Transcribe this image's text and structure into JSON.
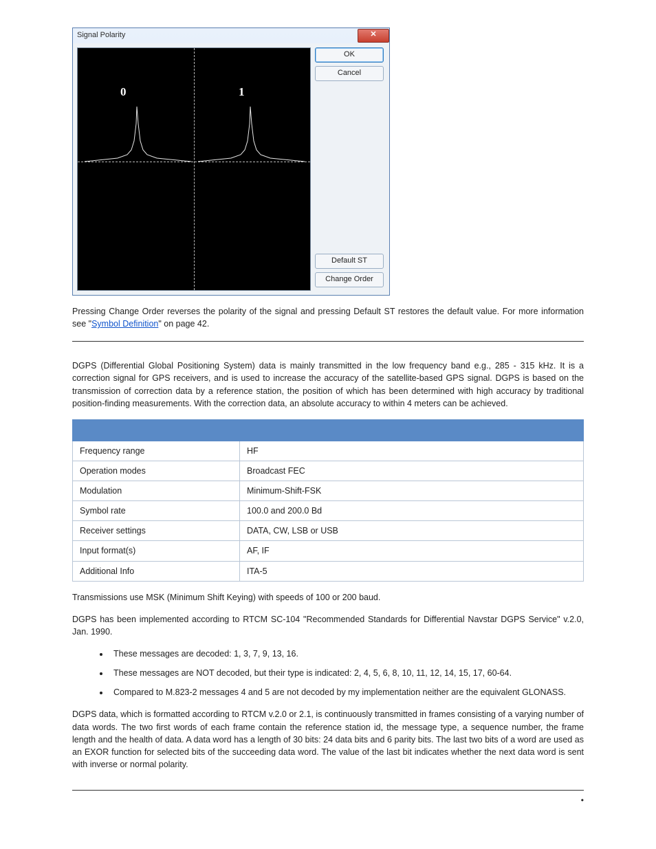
{
  "dialog": {
    "title": "Signal Polarity",
    "close_symbol": "✕",
    "label0": "0",
    "label1": "1",
    "buttons": {
      "ok": "OK",
      "cancel": "Cancel",
      "default_st": "Default ST",
      "change_order": "Change Order"
    }
  },
  "caption": {
    "before_link": "Pressing Change Order reverses the polarity of the signal and pressing Default ST restores the default value. For more information see \"",
    "link_text": "Symbol Definition",
    "after_link": "\" on page 42."
  },
  "intro": "DGPS (Differential Global Positioning System) data is mainly transmitted in the low frequency band e.g., 285 - 315 kHz. It is a correction signal for GPS receivers, and is used to increase the accuracy of the satellite-based GPS signal. DGPS is based on the transmission of correction data by a reference station, the position of which has been determined with high accuracy by traditional position-finding measurements. With the correction data, an absolute accuracy to within 4 meters can be achieved.",
  "spec_table": [
    {
      "k": "Frequency range",
      "v": "HF"
    },
    {
      "k": "Operation modes",
      "v": "Broadcast FEC"
    },
    {
      "k": "Modulation",
      "v": "Minimum-Shift-FSK"
    },
    {
      "k": "Symbol rate",
      "v": "100.0 and 200.0 Bd"
    },
    {
      "k": "Receiver settings",
      "v": "DATA, CW, LSB or USB"
    },
    {
      "k": "Input format(s)",
      "v": "AF, IF"
    },
    {
      "k": "Additional Info",
      "v": "ITA-5"
    }
  ],
  "after_table_1": "Transmissions use MSK (Minimum Shift Keying) with speeds of 100 or 200 baud.",
  "after_table_2": "DGPS has been implemented according to RTCM SC-104 \"Recommended Standards for Differential Navstar DGPS Service\" v.2.0, Jan. 1990.",
  "bullets": [
    "These messages are decoded: 1, 3, 7, 9, 13, 16.",
    "These messages are NOT decoded, but their type is indicated: 2, 4, 5, 6, 8, 10, 11, 12, 14, 15, 17, 60-64.",
    "Compared to M.823-2 messages 4 and 5 are not decoded by my implementation neither are the equivalent GLONASS."
  ],
  "closing": "DGPS data, which is formatted according to RTCM v.2.0 or 2.1, is continuously transmitted in frames consisting of a varying number of data words. The two first words of each frame contain the reference station id, the message type, a sequence number, the frame length and the health of data. A data word has a length of 30 bits: 24 data bits and 6 parity bits. The last two bits of a word are used as an EXOR function for selected bits of the succeeding data word. The value of the last bit indicates whether the next data word is sent with inverse or normal polarity.",
  "footer_dot": "•"
}
